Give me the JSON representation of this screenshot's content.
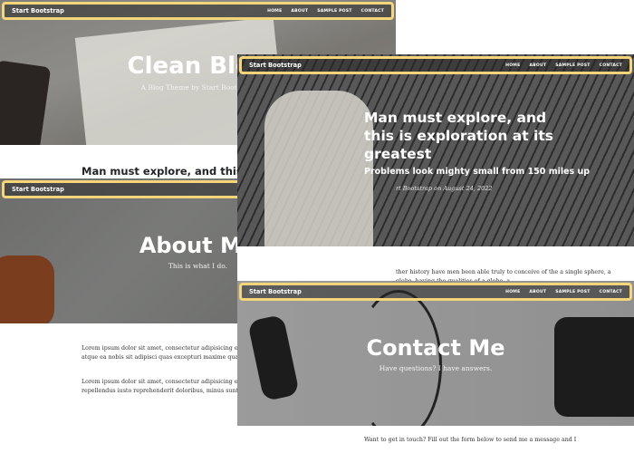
{
  "nav": {
    "brand": "Start Bootstrap",
    "links": [
      "HOME",
      "ABOUT",
      "SAMPLE POST",
      "CONTACT"
    ]
  },
  "home": {
    "title": "Clean Blog",
    "subtitle": "A Blog Theme by Start Bootstrap",
    "post_title": "Man must explore, and this is"
  },
  "post": {
    "title": "Man must explore, and this is exploration at its greatest",
    "subtitle": "Problems look mighty small from 150 miles up",
    "meta": "rt Bootstrap on August 24, 2022",
    "body": "ther history have men been able truly to conceive of the a single sphere, a globe, having the qualities of a globe, a"
  },
  "about": {
    "title": "About Me",
    "subtitle": "This is what I do.",
    "paragraphs": [
      "Lorem ipsum dolor sit amet, consectetur adipisicing elit. Saepe ullam eveniet pariatur voluptates odit, fuga atque ea nobis sit adipisci quas excepturi maxime quae totam ducimus consectetur",
      "Lorem ipsum dolor sit amet, consectetur adipisicing elit. Eius recusandae illo eaque architecto error, repellendus iusto reprehenderit doloribus, minus sunt. Numquam at quae voluptatum in"
    ]
  },
  "contact": {
    "title": "Contact Me",
    "subtitle": "Have questions? I have answers.",
    "intro": "Want to get in touch? Fill out the form below to send me a message and I"
  }
}
